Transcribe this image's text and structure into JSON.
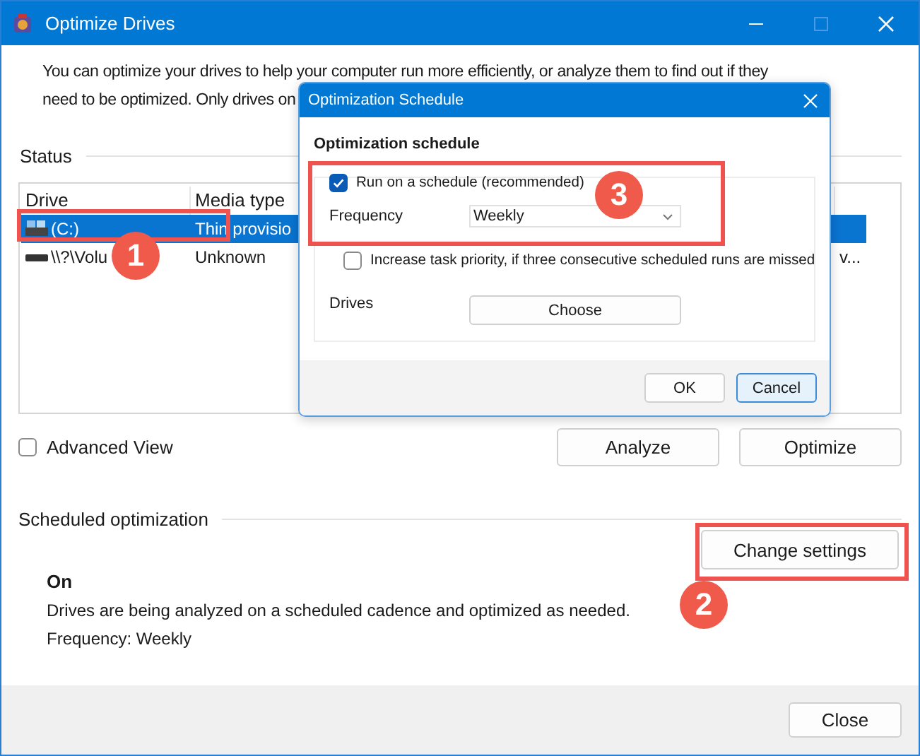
{
  "window": {
    "title": "Optimize Drives"
  },
  "description_lines": [
    "You can optimize your drives to help your computer run more efficiently, or analyze them to find out if they",
    "need to be optimized. Only drives on"
  ],
  "status": {
    "label": "Status",
    "columns": [
      "Drive",
      "Media type"
    ],
    "rows": [
      {
        "kind": "system",
        "selected": true,
        "cells": [
          "(C:)",
          "Thin provisio"
        ]
      },
      {
        "kind": "volume",
        "selected": false,
        "cells": [
          "\\\\?\\Volu",
          "Unknown",
          "v..."
        ]
      }
    ]
  },
  "advanced_view": {
    "label": "Advanced View",
    "checked": false
  },
  "actions": [
    "Analyze",
    "Optimize"
  ],
  "scheduled": {
    "label": "Scheduled optimization",
    "state": "On",
    "text": "Drives are being analyzed on a scheduled cadence and optimized as needed.",
    "frequency": "Frequency: Weekly",
    "button": "Change settings"
  },
  "close_button": "Close",
  "dialog": {
    "title": "Optimization Schedule",
    "heading": "Optimization schedule",
    "run_schedule": {
      "label": "Run on a schedule (recommended)",
      "checked": true
    },
    "frequency": {
      "label": "Frequency",
      "value": "Weekly"
    },
    "priority": {
      "label": "Increase task priority, if three consecutive scheduled runs are missed",
      "checked": false
    },
    "drives": {
      "label": "Drives",
      "button": "Choose"
    },
    "buttons": [
      {
        "label": "OK",
        "selected": false
      },
      {
        "label": "Cancel",
        "selected": true
      }
    ]
  },
  "annotations": [
    {
      "number": "1"
    },
    {
      "number": "2"
    },
    {
      "number": "3"
    }
  ]
}
